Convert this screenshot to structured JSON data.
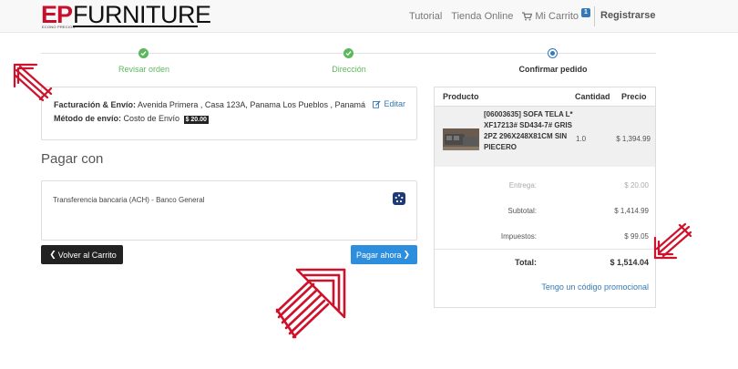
{
  "header": {
    "logo_ep": "EP",
    "logo_furniture": "FURNITURE",
    "logo_sub": "ECONO PRECIOS",
    "nav": {
      "tutorial": "Tutorial",
      "store": "Tienda Online",
      "cart": "Mi Carrito",
      "cart_count": "1",
      "register": "Registrarse"
    }
  },
  "steps": [
    {
      "label": "Revisar orden",
      "state": "done"
    },
    {
      "label": "Dirección",
      "state": "done"
    },
    {
      "label": "Confirmar pedido",
      "state": "current"
    }
  ],
  "order_info": {
    "billing_label": "Facturación & Envío:",
    "billing_value": " Avenida Primera , Casa 123A, Panama Los Pueblos , Panamá",
    "ship_label": "Método de envío:",
    "ship_value": " Costo de Envío",
    "ship_price": "$ 20.00",
    "edit": "Editar"
  },
  "payment": {
    "title": "Pagar con",
    "method": "Transferencia bancaria (ACH) - Banco General"
  },
  "buttons": {
    "back": "Volver al Carrito",
    "pay": "Pagar ahora"
  },
  "cart": {
    "headers": {
      "product": "Producto",
      "qty": "Cantidad",
      "price": "Precio"
    },
    "item": {
      "name": "[06003635] SOFA TELA L* XF17213# SD434-7# GRIS 2PZ 296X248X81CM SIN PIECERO",
      "qty": "1.0",
      "price": "$ 1,394.99"
    },
    "delivery_label": "Entrega:",
    "delivery_value": "$ 20.00",
    "subtotal_label": "Subtotal:",
    "subtotal_value": "$ 1,414.99",
    "tax_label": "Impuestos:",
    "tax_value": "$ 99.05",
    "total_label": "Total:",
    "total_value": "$ 1,514.04",
    "promo": "Tengo un código promocional"
  },
  "colors": {
    "brand_red": "#c8102e",
    "success": "#5cb85c",
    "primary": "#2e8ede",
    "link": "#337ab7",
    "annotation": "#d0112b"
  }
}
